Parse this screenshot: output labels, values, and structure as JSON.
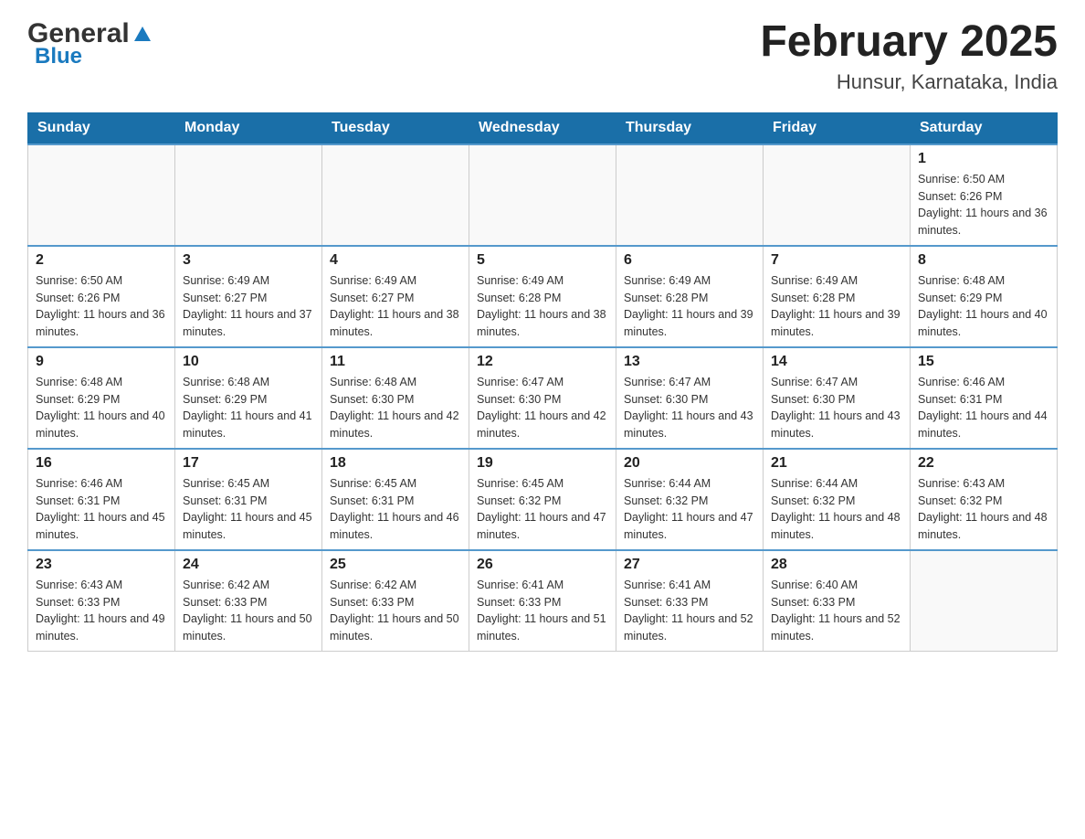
{
  "header": {
    "logo_general": "General",
    "logo_arrow": "▲",
    "logo_blue": "Blue",
    "title": "February 2025",
    "subtitle": "Hunsur, Karnataka, India"
  },
  "days_of_week": [
    "Sunday",
    "Monday",
    "Tuesday",
    "Wednesday",
    "Thursday",
    "Friday",
    "Saturday"
  ],
  "weeks": [
    [
      {
        "day": "",
        "info": ""
      },
      {
        "day": "",
        "info": ""
      },
      {
        "day": "",
        "info": ""
      },
      {
        "day": "",
        "info": ""
      },
      {
        "day": "",
        "info": ""
      },
      {
        "day": "",
        "info": ""
      },
      {
        "day": "1",
        "info": "Sunrise: 6:50 AM\nSunset: 6:26 PM\nDaylight: 11 hours and 36 minutes."
      }
    ],
    [
      {
        "day": "2",
        "info": "Sunrise: 6:50 AM\nSunset: 6:26 PM\nDaylight: 11 hours and 36 minutes."
      },
      {
        "day": "3",
        "info": "Sunrise: 6:49 AM\nSunset: 6:27 PM\nDaylight: 11 hours and 37 minutes."
      },
      {
        "day": "4",
        "info": "Sunrise: 6:49 AM\nSunset: 6:27 PM\nDaylight: 11 hours and 38 minutes."
      },
      {
        "day": "5",
        "info": "Sunrise: 6:49 AM\nSunset: 6:28 PM\nDaylight: 11 hours and 38 minutes."
      },
      {
        "day": "6",
        "info": "Sunrise: 6:49 AM\nSunset: 6:28 PM\nDaylight: 11 hours and 39 minutes."
      },
      {
        "day": "7",
        "info": "Sunrise: 6:49 AM\nSunset: 6:28 PM\nDaylight: 11 hours and 39 minutes."
      },
      {
        "day": "8",
        "info": "Sunrise: 6:48 AM\nSunset: 6:29 PM\nDaylight: 11 hours and 40 minutes."
      }
    ],
    [
      {
        "day": "9",
        "info": "Sunrise: 6:48 AM\nSunset: 6:29 PM\nDaylight: 11 hours and 40 minutes."
      },
      {
        "day": "10",
        "info": "Sunrise: 6:48 AM\nSunset: 6:29 PM\nDaylight: 11 hours and 41 minutes."
      },
      {
        "day": "11",
        "info": "Sunrise: 6:48 AM\nSunset: 6:30 PM\nDaylight: 11 hours and 42 minutes."
      },
      {
        "day": "12",
        "info": "Sunrise: 6:47 AM\nSunset: 6:30 PM\nDaylight: 11 hours and 42 minutes."
      },
      {
        "day": "13",
        "info": "Sunrise: 6:47 AM\nSunset: 6:30 PM\nDaylight: 11 hours and 43 minutes."
      },
      {
        "day": "14",
        "info": "Sunrise: 6:47 AM\nSunset: 6:30 PM\nDaylight: 11 hours and 43 minutes."
      },
      {
        "day": "15",
        "info": "Sunrise: 6:46 AM\nSunset: 6:31 PM\nDaylight: 11 hours and 44 minutes."
      }
    ],
    [
      {
        "day": "16",
        "info": "Sunrise: 6:46 AM\nSunset: 6:31 PM\nDaylight: 11 hours and 45 minutes."
      },
      {
        "day": "17",
        "info": "Sunrise: 6:45 AM\nSunset: 6:31 PM\nDaylight: 11 hours and 45 minutes."
      },
      {
        "day": "18",
        "info": "Sunrise: 6:45 AM\nSunset: 6:31 PM\nDaylight: 11 hours and 46 minutes."
      },
      {
        "day": "19",
        "info": "Sunrise: 6:45 AM\nSunset: 6:32 PM\nDaylight: 11 hours and 47 minutes."
      },
      {
        "day": "20",
        "info": "Sunrise: 6:44 AM\nSunset: 6:32 PM\nDaylight: 11 hours and 47 minutes."
      },
      {
        "day": "21",
        "info": "Sunrise: 6:44 AM\nSunset: 6:32 PM\nDaylight: 11 hours and 48 minutes."
      },
      {
        "day": "22",
        "info": "Sunrise: 6:43 AM\nSunset: 6:32 PM\nDaylight: 11 hours and 48 minutes."
      }
    ],
    [
      {
        "day": "23",
        "info": "Sunrise: 6:43 AM\nSunset: 6:33 PM\nDaylight: 11 hours and 49 minutes."
      },
      {
        "day": "24",
        "info": "Sunrise: 6:42 AM\nSunset: 6:33 PM\nDaylight: 11 hours and 50 minutes."
      },
      {
        "day": "25",
        "info": "Sunrise: 6:42 AM\nSunset: 6:33 PM\nDaylight: 11 hours and 50 minutes."
      },
      {
        "day": "26",
        "info": "Sunrise: 6:41 AM\nSunset: 6:33 PM\nDaylight: 11 hours and 51 minutes."
      },
      {
        "day": "27",
        "info": "Sunrise: 6:41 AM\nSunset: 6:33 PM\nDaylight: 11 hours and 52 minutes."
      },
      {
        "day": "28",
        "info": "Sunrise: 6:40 AM\nSunset: 6:33 PM\nDaylight: 11 hours and 52 minutes."
      },
      {
        "day": "",
        "info": ""
      }
    ]
  ]
}
